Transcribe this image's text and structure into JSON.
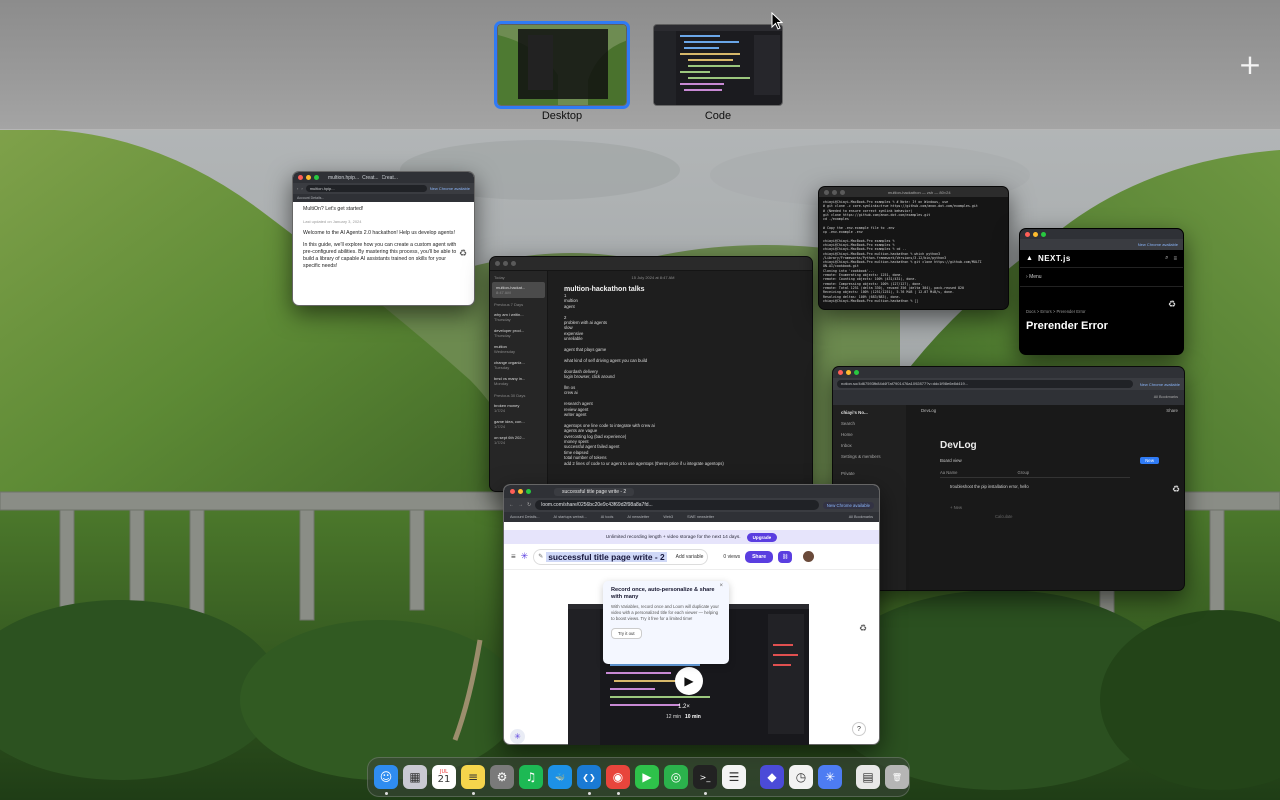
{
  "spaces": [
    {
      "label": "Desktop",
      "active": true
    },
    {
      "label": "Code",
      "active": false
    }
  ],
  "add_space_icon": "plus-icon",
  "windows": {
    "chrome_top_left": {
      "tab1": "multion.hpip...",
      "tab2": "Creat...",
      "tab3": "Creat...",
      "url": "multion.hpip...",
      "chrome_badge": "New Chrome available",
      "bookmarks": "Account Details...",
      "lines": [
        "MultiOn? Let's get started!",
        "Last updated on January 3, 2024"
      ],
      "para1": "Welcome to the AI Agents 2.0 hackathon! Help us develop agents!",
      "para2": "In this guide, we'll explore how you can create a custom agent with pre-configured abilities. By mastering this process, you'll be able to build a library of capable AI assistants trained on skills for your specific needs!"
    },
    "notes": {
      "date": "15 July 2024 at 8:47 AM",
      "sidebar": [
        {
          "section": "Today"
        },
        {
          "title": "multion-hackat...",
          "meta": "8:47 AM",
          "selected": true
        },
        {
          "section": "Previous 7 Days"
        },
        {
          "title": "why am i writin...",
          "meta": "Thursday"
        },
        {
          "title": "developer prod...",
          "meta": "Thursday"
        },
        {
          "title": "multion",
          "meta": "Wednesday"
        },
        {
          "title": "change organiz...",
          "meta": "Tuesday"
        },
        {
          "title": "bmd vs many in...",
          "meta": "Monday"
        },
        {
          "section": "Previous 30 Days"
        },
        {
          "title": "broken money",
          "meta": "1/7/24"
        },
        {
          "title": "game idea, con...",
          "meta": "1/7/24"
        },
        {
          "title": "on sept 6th 202...",
          "meta": "1/7/24"
        }
      ],
      "title": "multion-hackathon talks",
      "lines": [
        "1",
        "multion",
        "agent",
        "",
        "2",
        "problem with ai agents",
        "slow",
        "expensive",
        "unreliable",
        "",
        "agent that plays game",
        "",
        "what kind of self driving agent you can build",
        "",
        "doordash delivery",
        "login browser, click around",
        "",
        "llm os",
        "crew ai",
        "",
        "research agent",
        "review agent",
        "writer agent",
        "",
        "agentops one line code to integrate with crew ai",
        "agents are vague",
        "overcosting log (bad experience)",
        "money spent",
        "successful agent failed agent",
        "time elapsed",
        "total number of tokens",
        "add 2 lines of code to ur agent to use agentops (theres price if u integrate agentops)"
      ]
    },
    "terminal": {
      "title": "multion-hackathon — zsh — 80×24",
      "lines": [
        "chiayi@Chiayi-MacBook-Pro examples % # Note: If on Windows, use",
        "# git clone -c core.symlinks=true https://github.com/anon-dot-com/examples.git",
        "# (Needed to ensure correct symlink behavior)",
        "git clone https://github.com/anon-dot-com/examples.git",
        "cd ./examples",
        "",
        "# Copy the .env.example file to .env",
        "cp .env.example .env",
        "",
        "chiayi@Chiayi-MacBook-Pro examples %",
        "chiayi@Chiayi-MacBook-Pro examples %",
        "chiayi@Chiayi-MacBook-Pro examples % cd ..",
        "chiayi@Chiayi-MacBook-Pro multion-hackathon % which python3",
        "/Library/Frameworks/Python.framework/Versions/3.12/bin/python3",
        "chiayi@Chiayi-MacBook-Pro multion-hackathon % git clone https://github.com/MULTI",
        "ON-AI/cookbook.git",
        "Cloning into 'cookbook'...",
        "remote: Enumerating objects: 1251, done.",
        "remote: Counting objects: 100% (431/431), done.",
        "remote: Compressing objects: 100% (127/127), done.",
        "remote: Total 1251 (delta 330), reused 356 (delta 304), pack-reused 820",
        "Receiving objects: 100% (1251/1251), 5.76 MiB | 12.07 MiB/s, done.",
        "Resolving deltas: 100% (683/683), done.",
        "chiayi@Chiayi-MacBook-Pro multion-hackathon % []"
      ]
    },
    "next": {
      "chrome_badge": "New Chrome available",
      "logo": "NEXT.js",
      "menu": "Menu",
      "crumb": "Docs  >  Errors  >  Prerender Error",
      "heading": "Prerender Error"
    },
    "notion": {
      "url": "notion.so/4d67593fb84d4f7af7901476a1092877?v=ddc1f98e6e8d419...",
      "chrome_badge": "New Chrome available",
      "bookmarks": "All Bookmarks",
      "workspace": "chiayi's No...",
      "sidebar": [
        "Search",
        "Home",
        "Inbox",
        "Settings & members",
        "",
        "Private"
      ],
      "breadcrumb": "DevLog",
      "share": "Share",
      "title": "DevLog",
      "view": "Board view",
      "new_btn": "New",
      "col_name": "Aa Name",
      "col_group": "Group",
      "row1": "troubleshoot the pip installation error, hello",
      "add_row": "+ New",
      "calculate": "Calculate"
    },
    "loom": {
      "tab": "successful title page write - 2",
      "url": "loom.com/share/0256bc20e9c43f69d2f98a8a7fd...",
      "chrome_badge": "New Chrome available",
      "bookmarks": [
        "Account Details...",
        "AI startups websit...",
        "AI tools",
        "AI newsletter",
        "Web3",
        "SWE newsletter",
        "All Bookmarks"
      ],
      "banner": "Unlimited recording length + video storage for the next 14 days.",
      "upgrade": "Upgrade",
      "title": "successful title page write - 2",
      "add_variable": "Add variable",
      "views": "0 views",
      "share": "Share",
      "popup_title": "Record once, auto-personalize & share with many",
      "popup_body": "With Variables, record once and Loom will duplicate your video with a personalized title for each viewer — helping to boost views. Try it free for a limited time!",
      "popup_button": "Try it out",
      "speed": "1.2×",
      "duration_a": "12 min",
      "duration_b": "10 min",
      "help": "?"
    }
  },
  "dock": [
    {
      "name": "finder-icon",
      "glyph": "☺",
      "bg": "#2f8cf0",
      "running": true
    },
    {
      "name": "launchpad-icon",
      "glyph": "▦",
      "bg": "#c9c9d2",
      "running": false
    },
    {
      "name": "calendar-icon",
      "glyph": "21",
      "bg": "#ffffff",
      "running": false
    },
    {
      "name": "notes-icon",
      "glyph": "≡",
      "bg": "#f5d54c",
      "running": true
    },
    {
      "name": "system-settings-icon",
      "glyph": "⚙",
      "bg": "#7a7a7a",
      "running": false
    },
    {
      "name": "spotify-icon",
      "glyph": "♫",
      "bg": "#1db954",
      "running": false
    },
    {
      "name": "docker-icon",
      "glyph": "🐳",
      "bg": "#1d91e6",
      "running": false
    },
    {
      "name": "vscode-icon",
      "glyph": "❮❯",
      "bg": "#1a7ad4",
      "running": true
    },
    {
      "name": "chrome-icon",
      "glyph": "◉",
      "bg": "#e8453c",
      "running": true
    },
    {
      "name": "facetime-icon",
      "glyph": "▶",
      "bg": "#2ec24a",
      "running": false
    },
    {
      "name": "find-my-icon",
      "glyph": "◎",
      "bg": "#2bb24c",
      "running": false
    },
    {
      "name": "terminal-icon",
      "glyph": ">_",
      "bg": "#222222",
      "running": true
    },
    {
      "name": "reminders-icon",
      "glyph": "☰",
      "bg": "#f4f4f4",
      "running": false
    },
    {
      "sep": true
    },
    {
      "name": "shortcuts-icon",
      "glyph": "◆",
      "bg": "#4b4bd8",
      "running": false
    },
    {
      "name": "clock-icon",
      "glyph": "◷",
      "bg": "#f2f2f2",
      "running": false
    },
    {
      "name": "perplexity-icon",
      "glyph": "✳",
      "bg": "#4d7cf2",
      "running": false
    },
    {
      "sep": true
    },
    {
      "name": "downloads-icon",
      "glyph": "▤",
      "bg": "#e8e8e8",
      "running": false
    },
    {
      "name": "trash-icon",
      "glyph": "🗑",
      "bg": "#b5b5b5",
      "running": false
    }
  ],
  "dock_calendar_month": "JUL",
  "colors": {
    "accent": "#2f7bf5",
    "loom_purple": "#5a3ee0"
  }
}
